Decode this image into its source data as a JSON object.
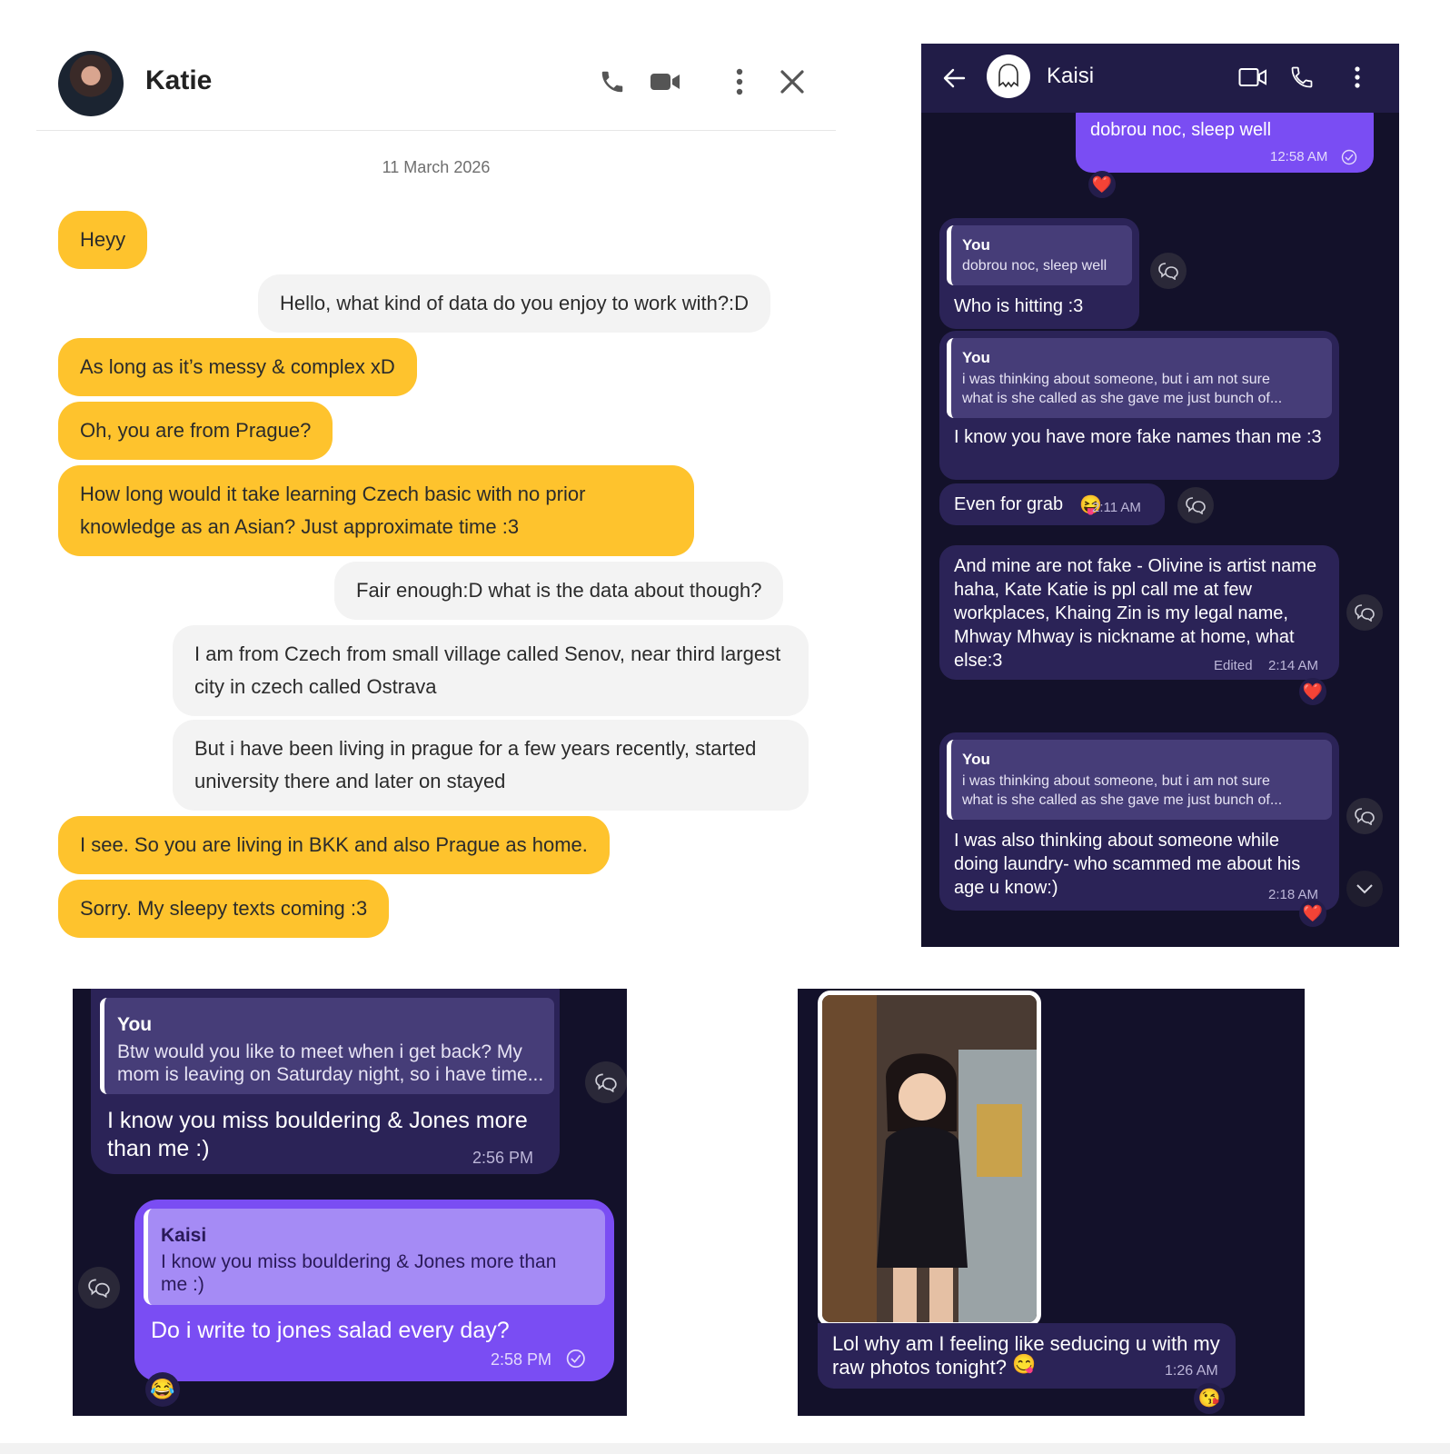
{
  "panel_a": {
    "contact_name": "Katie",
    "date": "11 March 2026",
    "messages": [
      {
        "side": "left",
        "text": "Heyy"
      },
      {
        "side": "right",
        "text": "Hello, what kind of data do you enjoy to work with?:D"
      },
      {
        "side": "left",
        "text": "As long as it’s messy & complex xD"
      },
      {
        "side": "left",
        "text": "Oh, you are from Prague?"
      },
      {
        "side": "left",
        "text": "How long would it take learning Czech basic with no prior knowledge as an Asian? Just approximate time :3"
      },
      {
        "side": "right",
        "text": "Fair enough:D what is the data about though?"
      },
      {
        "side": "right",
        "text": "I am from Czech from small village called Senov, near third largest city in czech called Ostrava"
      },
      {
        "side": "right",
        "text": "But i have been living in prague for a few years recently, started university there and later on stayed"
      },
      {
        "side": "left",
        "text": "I see. So you are living in BKK and also Prague as home."
      },
      {
        "side": "left",
        "text": "Sorry. My sleepy texts coming :3"
      }
    ],
    "colors": {
      "incoming": "#fec32d",
      "outgoing": "#f3f3f3"
    }
  },
  "panel_b": {
    "contact_name": "Kaisi",
    "msg1": {
      "text": "dobrou noc, sleep well",
      "time": "12:58 AM",
      "reaction": "❤️"
    },
    "msg2": {
      "quote_name": "You",
      "quote_text": "dobrou noc, sleep well",
      "text": "Who is hitting :3"
    },
    "msg3": {
      "quote_name": "You",
      "quote_line1": "i was thinking about someone, but i am not sure",
      "quote_line2": "what is she called as she gave me just bunch of...",
      "text": "I know you have more fake names than me :3"
    },
    "msg4": {
      "text": "Even for grab",
      "emoji": "😝",
      "time": "2:11 AM"
    },
    "msg5": {
      "text": "And mine are not fake - Olivine is artist name haha, Kate Katie is ppl call me at few workplaces, Khaing Zin is my legal name, Mhway Mhway is nickname at home, what else:3",
      "edited": "Edited",
      "time": "2:14 AM",
      "reaction": "❤️"
    },
    "msg6": {
      "quote_name": "You",
      "quote_line1": "i was thinking about someone, but i am not sure",
      "quote_line2": "what is she called as she gave me just bunch of...",
      "text": "I was also thinking about someone while doing laundry- who scammed me about his age u know:)",
      "time": "2:18 AM",
      "reaction": "❤️"
    },
    "colors": {
      "header": "#211c47",
      "bubble": "#2b2357",
      "outgoing": "#7a4df3"
    }
  },
  "panel_c": {
    "msg1": {
      "quote_name": "You",
      "quote_line1": "Btw would you like to meet when i get back? My",
      "quote_line2": "mom is leaving on Saturday night, so i have time...",
      "text": "I know you miss bouldering & Jones more than me :)",
      "time": "2:56 PM"
    },
    "msg2": {
      "quote_name": "Kaisi",
      "quote_text": "I know you miss bouldering & Jones more than me :)",
      "text": "Do i write to jones salad every day?",
      "time": "2:58 PM",
      "reaction": "😂"
    }
  },
  "panel_d": {
    "caption": "Lol why am I feeling like seducing u with my raw photos tonight?",
    "emoji": "😋",
    "time": "1:26 AM",
    "reaction": "😘"
  }
}
